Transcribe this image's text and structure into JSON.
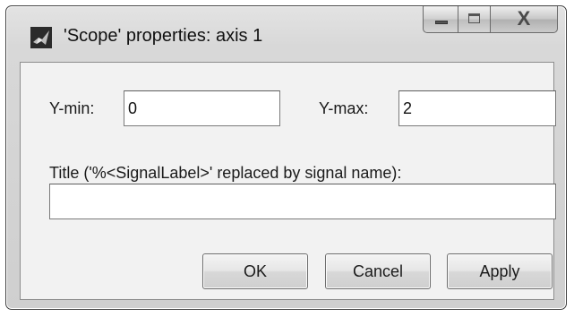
{
  "window": {
    "title": "'Scope' properties: axis 1",
    "icon": "matlab-icon",
    "caption_buttons": {
      "minimize_icon": "minimize-icon",
      "maximize_icon": "maximize-icon",
      "close_glyph": "X"
    }
  },
  "form": {
    "ymin_label": "Y-min:",
    "ymin_value": "0",
    "ymax_label": "Y-max:",
    "ymax_value": "2",
    "title_label": "Title ('%<SignalLabel>' replaced by signal name):",
    "title_value": ""
  },
  "buttons": {
    "ok": "OK",
    "cancel": "Cancel",
    "apply": "Apply"
  }
}
